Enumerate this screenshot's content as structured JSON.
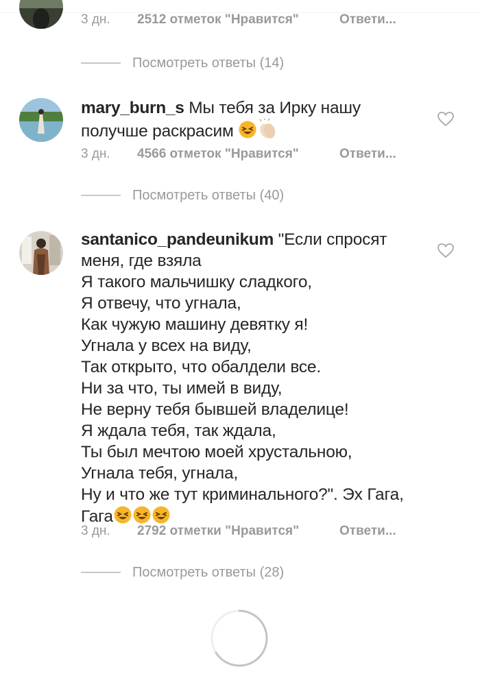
{
  "comments": [
    {
      "text": "",
      "time": "3 дн.",
      "likes": "2512 отметок \"Нравится\"",
      "reply": "Ответи...",
      "view_replies": "Посмотреть ответы (14)"
    },
    {
      "author": "mary_burn_s",
      "text_lines": [
        "Мы тебя за Ирку нашу",
        "получше раскрасим"
      ],
      "emojis": [
        "laughing-face",
        "clapping-hands"
      ],
      "time": "3 дн.",
      "likes": "4566 отметок \"Нравится\"",
      "reply": "Ответи...",
      "view_replies": "Посмотреть ответы (40)"
    },
    {
      "author": "santanico_pandeunikum",
      "text_lines": [
        "\"Если спросят",
        "меня, где взяла",
        "Я такого мальчишку сладкого,",
        "Я отвечу, что угнала,",
        "Как чужую машину девятку я!",
        "Угнала у всех на виду,",
        "Так открыто, что обалдели все.",
        "Ни за что, ты имей в виду,",
        "Не верну тебя бывшей владелице!",
        "Я ждала тебя, так ждала,",
        "Ты был мечтою моей хрустальною,",
        "Угнала тебя, угнала,",
        "Ну и что же тут криминального?\". Эх Гага,",
        "Гага"
      ],
      "emojis": [
        "laughing-face",
        "laughing-face",
        "laughing-face"
      ],
      "time": "3 дн.",
      "likes": "2792 отметки \"Нравится\"",
      "reply": "Ответи...",
      "view_replies": "Посмотреть ответы (28)"
    }
  ],
  "colors": {
    "text": "#262626",
    "meta": "#999999",
    "divider": "#c7c7c7",
    "emoji": "#f7b52c"
  },
  "icons": {
    "like": "heart-outline-icon",
    "loading": "loading-spinner-icon"
  }
}
